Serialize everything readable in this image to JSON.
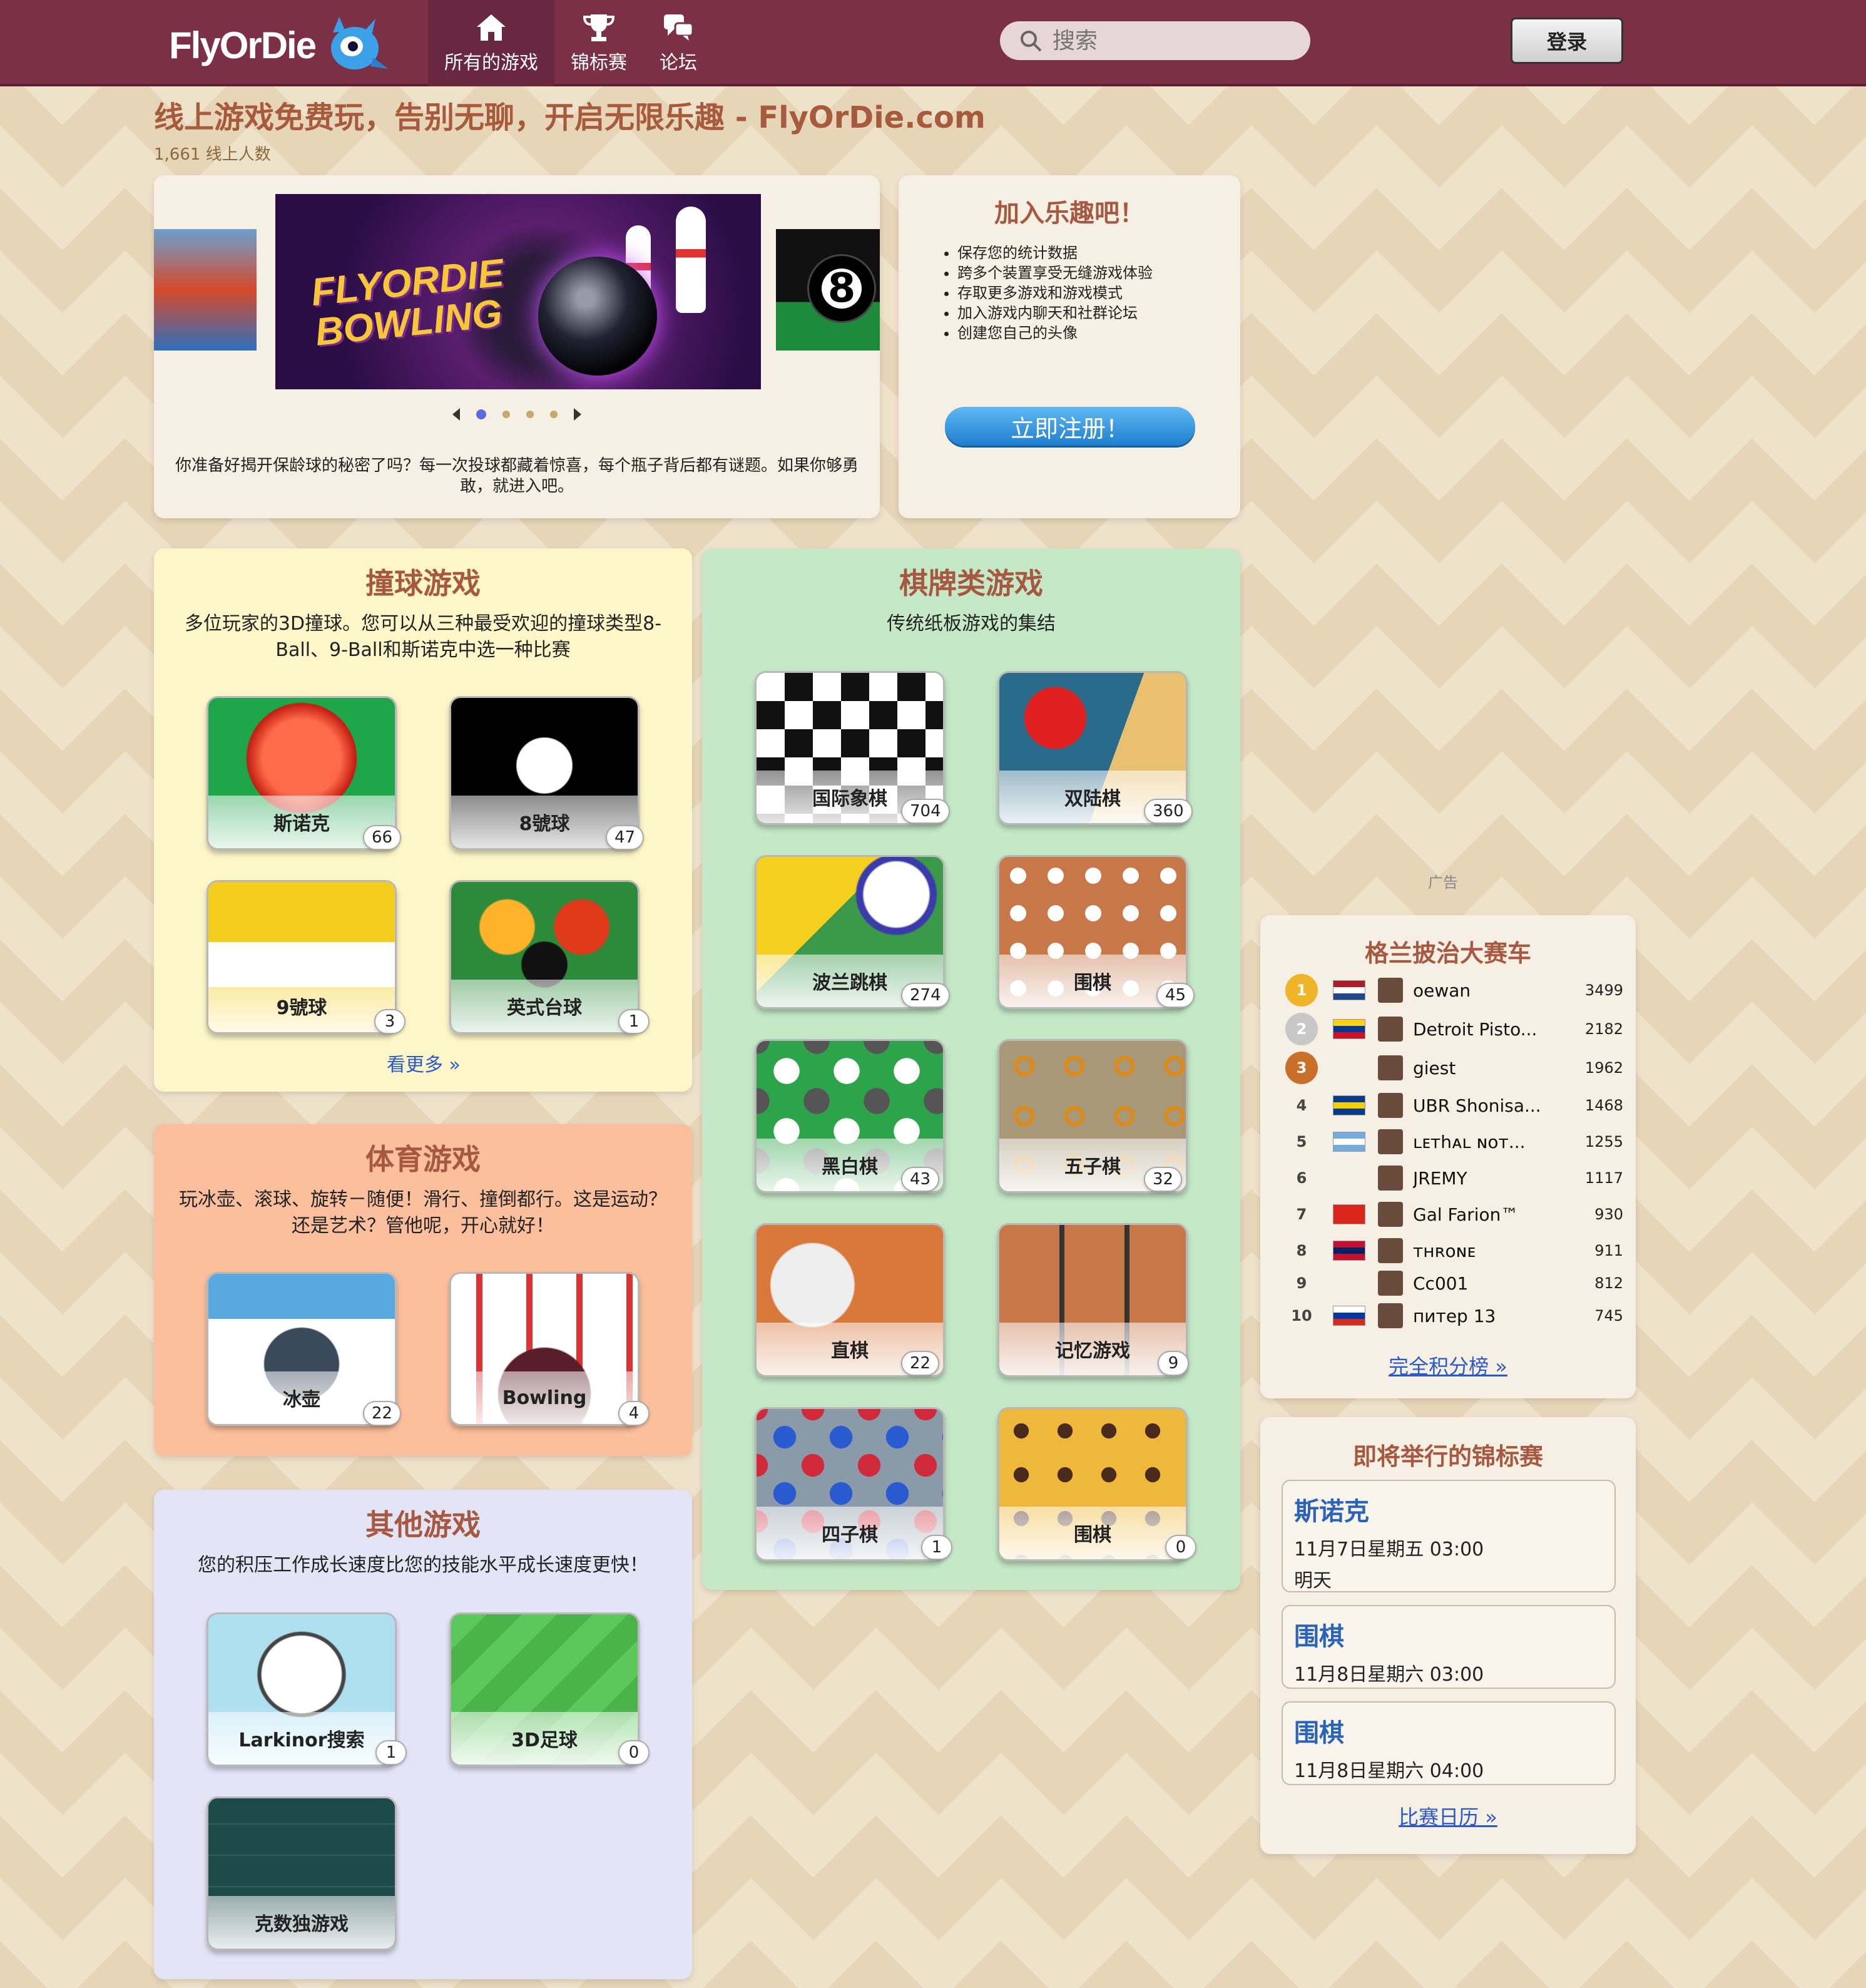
{
  "header": {
    "logo_text": "FlyOrDie",
    "nav": [
      {
        "label": "所有的游戏",
        "icon": "home-icon"
      },
      {
        "label": "锦标赛",
        "icon": "trophy-icon"
      },
      {
        "label": "论坛",
        "icon": "chat-icon"
      }
    ],
    "search_placeholder": "搜索",
    "login_label": "登录"
  },
  "headline": "线上游戏免费玩，告别无聊，开启无限乐趣 - FlyOrDie.com",
  "online_count": "1,661 线上人数",
  "carousel": {
    "featured_title_line1": "FLYORDIE",
    "featured_title_line2": "BOWLING",
    "right_ball_number": "8",
    "caption": "你准备好揭开保龄球的秘密了吗？每一次投球都藏着惊喜，每个瓶子背后都有谜题。如果你够勇敢，就进入吧。",
    "active_slide": 1,
    "slide_count": 5
  },
  "join": {
    "title": "加入乐趣吧！",
    "benefits": [
      "保存您的统计数据",
      "跨多个装置享受无缝游戏体验",
      "存取更多游戏和游戏模式",
      "加入游戏内聊天和社群论坛",
      "创建您自己的头像"
    ],
    "button": "立即注册！"
  },
  "billiards": {
    "title": "撞球游戏",
    "desc": "多位玩家的3D撞球。您可以从三种最受欢迎的撞球类型8-Ball、9-Ball和斯诺克中选一种比赛",
    "games": [
      {
        "name": "斯诺克",
        "count": "66"
      },
      {
        "name": "8號球",
        "count": "47"
      },
      {
        "name": "9號球",
        "count": "3"
      },
      {
        "name": "英式台球",
        "count": "1"
      }
    ],
    "see_more": "看更多 »"
  },
  "sports": {
    "title": "体育游戏",
    "desc": "玩冰壶、滚球、旋转－随便！滑行、撞倒都行。这是运动？还是艺术？管他呢，开心就好！",
    "games": [
      {
        "name": "冰壶",
        "count": "22"
      },
      {
        "name": "Bowling",
        "count": "4"
      }
    ]
  },
  "other": {
    "title": "其他游戏",
    "desc": "您的积压工作成长速度比您的技能水平成长速度更快！",
    "games": [
      {
        "name": "Larkinor搜索",
        "count": "1"
      },
      {
        "name": "3D足球",
        "count": "0"
      },
      {
        "name": "克数独游戏",
        "count": ""
      }
    ]
  },
  "board": {
    "title": "棋牌类游戏",
    "desc": "传统纸板游戏的集结",
    "games": [
      {
        "name": "国际象棋",
        "count": "704"
      },
      {
        "name": "双陆棋",
        "count": "360"
      },
      {
        "name": "波兰跳棋",
        "count": "274"
      },
      {
        "name": "围棋",
        "count": "45"
      },
      {
        "name": "黑白棋",
        "count": "43"
      },
      {
        "name": "五子棋",
        "count": "32"
      },
      {
        "name": "直棋",
        "count": "22"
      },
      {
        "name": "记忆游戏",
        "count": "9"
      },
      {
        "name": "四子棋",
        "count": "1"
      },
      {
        "name": "围棋",
        "count": "0"
      }
    ]
  },
  "ad_label": "广告",
  "leaderboard": {
    "title": "格兰披治大赛车",
    "rows": [
      {
        "rank": "1",
        "name": "oewan",
        "score": "3499",
        "flag": [
          "#ae1c28",
          "#ffffff",
          "#21468b"
        ],
        "medal": "#f0b428"
      },
      {
        "rank": "2",
        "name": "Detroit Pisto...",
        "score": "2182",
        "flag": [
          "#fcd116",
          "#003893",
          "#ce1126"
        ],
        "medal": "#c8c8c8"
      },
      {
        "rank": "3",
        "name": "giest",
        "score": "1962",
        "flag": null,
        "medal": "#c8702a"
      },
      {
        "rank": "4",
        "name": "UBR Shonisa...",
        "score": "1468",
        "flag": [
          "#0a3a8a",
          "#f8d000",
          "#0a3a8a"
        ],
        "medal": null
      },
      {
        "rank": "5",
        "name": "ʟᴇтһᴀʟ ɴᴏт...",
        "score": "1255",
        "flag": [
          "#74acdf",
          "#ffffff",
          "#74acdf"
        ],
        "medal": null
      },
      {
        "rank": "6",
        "name": "JREMY",
        "score": "1117",
        "flag": null,
        "medal": null
      },
      {
        "rank": "7",
        "name": "Gal Farion™",
        "score": "930",
        "flag": [
          "#da251d",
          "#da251d",
          "#da251d"
        ],
        "medal": null
      },
      {
        "rank": "8",
        "name": "ᴛʜʀᴏɴᴇ",
        "score": "911",
        "flag": [
          "#c8102e",
          "#012169",
          "#c8102e"
        ],
        "medal": null
      },
      {
        "rank": "9",
        "name": "Cc001",
        "score": "812",
        "flag": null,
        "medal": null
      },
      {
        "rank": "10",
        "name": "питер 13",
        "score": "745",
        "flag": [
          "#ffffff",
          "#0039a6",
          "#d52b1e"
        ],
        "medal": null
      }
    ],
    "link": "完全积分榜 »"
  },
  "tournaments": {
    "title": "即将举行的锦标赛",
    "items": [
      {
        "name": "斯诺克",
        "time": "11月7日星期五 03:00",
        "relative": "明天"
      },
      {
        "name": "围棋",
        "time": "11月8日星期六 03:00",
        "relative": ""
      },
      {
        "name": "围棋",
        "time": "11月8日星期六 04:00",
        "relative": ""
      }
    ],
    "link": "比赛日历 »"
  },
  "colors": {
    "topbar": "#7b3048",
    "headline": "#a85a3c",
    "billiards_bg": "#fdf6c9",
    "sports_bg": "#fbbf9d",
    "other_bg": "#e4e4f7",
    "board_bg": "#c5e9c7",
    "link": "#2a5ac8"
  }
}
